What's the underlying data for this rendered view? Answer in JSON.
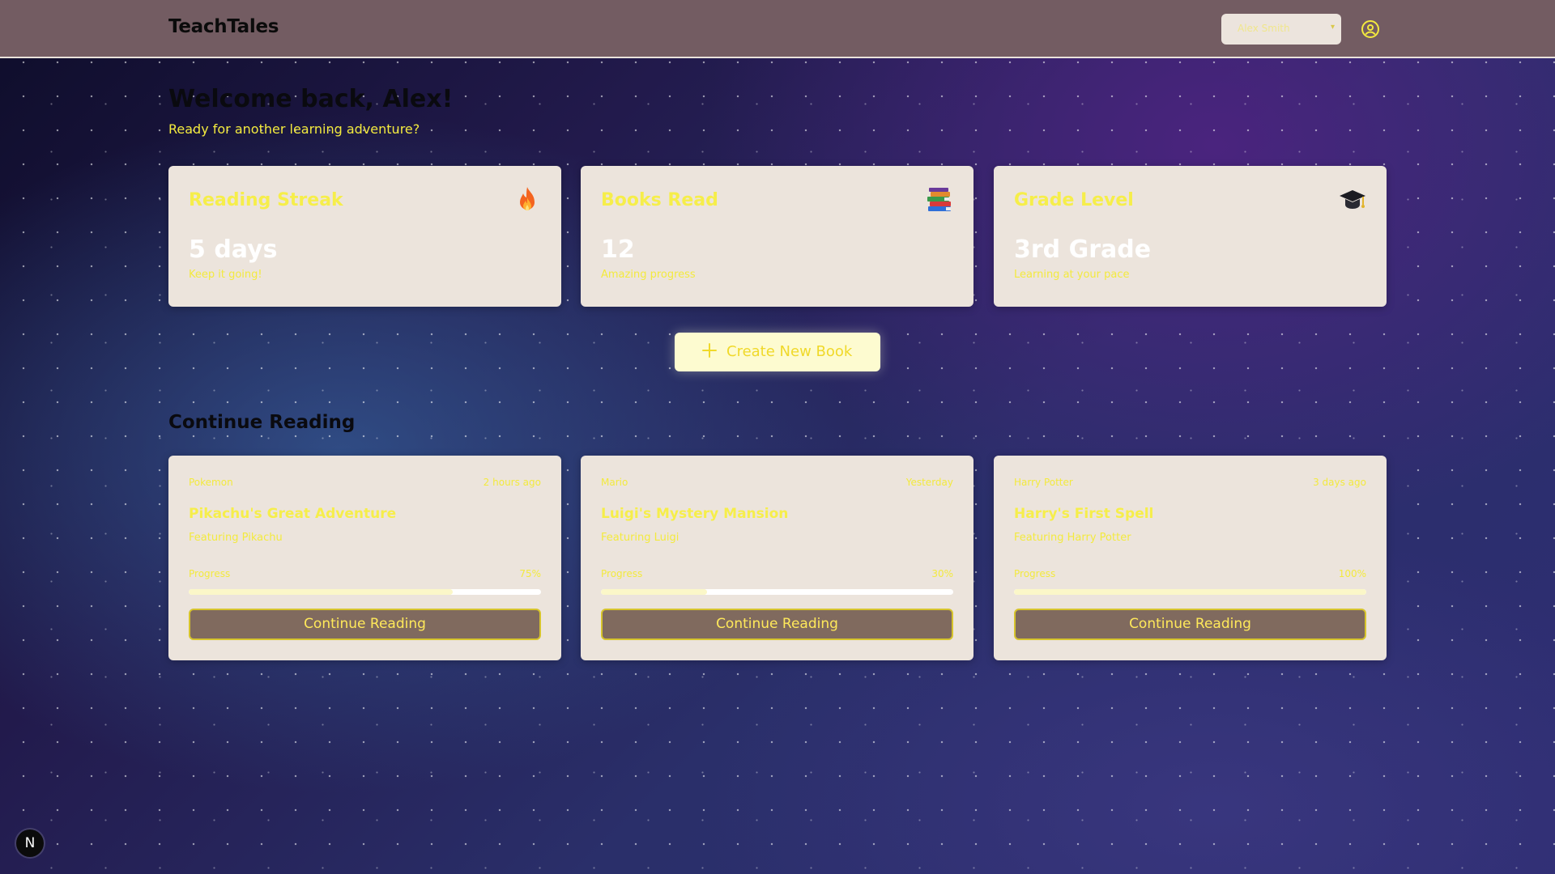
{
  "app": {
    "brand": "TeachTales"
  },
  "header": {
    "user_select_value": "Alex Smith",
    "profile_icon": "user-circle-icon"
  },
  "welcome": {
    "title": "Welcome back, Alex!",
    "subtitle": "Ready for another learning adventure?"
  },
  "stats": [
    {
      "title": "Reading Streak",
      "emoji": "🔥",
      "icon": "fire-icon",
      "value": "5 days",
      "note": "Keep it going!"
    },
    {
      "title": "Books Read",
      "emoji": "📚",
      "icon": "books-icon",
      "value": "12",
      "note": "Amazing progress"
    },
    {
      "title": "Grade Level",
      "emoji": "🎓",
      "icon": "graduation-cap-icon",
      "value": "3rd Grade",
      "note": "Learning at your pace"
    }
  ],
  "create_button": {
    "label": "Create New Book",
    "icon": "plus-icon"
  },
  "continue_section": {
    "title": "Continue Reading"
  },
  "books": [
    {
      "series": "Pokemon",
      "time": "2 hours ago",
      "title": "Pikachu's Great Adventure",
      "featuring": "Featuring Pikachu",
      "progress_label": "Progress",
      "progress_text": "75%",
      "progress": 75,
      "button": "Continue Reading"
    },
    {
      "series": "Mario",
      "time": "Yesterday",
      "title": "Luigi's Mystery Mansion",
      "featuring": "Featuring Luigi",
      "progress_label": "Progress",
      "progress_text": "30%",
      "progress": 30,
      "button": "Continue Reading"
    },
    {
      "series": "Harry Potter",
      "time": "3 days ago",
      "title": "Harry's First Spell",
      "featuring": "Featuring Harry Potter",
      "progress_label": "Progress",
      "progress_text": "100%",
      "progress": 100,
      "button": "Continue Reading"
    }
  ],
  "dev_badge": {
    "label": "N"
  },
  "colors": {
    "header_bg": "#735c62",
    "card_bg": "#ece4dc",
    "accent_yellow": "#f3ea3e",
    "button_bg": "#806a5e"
  }
}
